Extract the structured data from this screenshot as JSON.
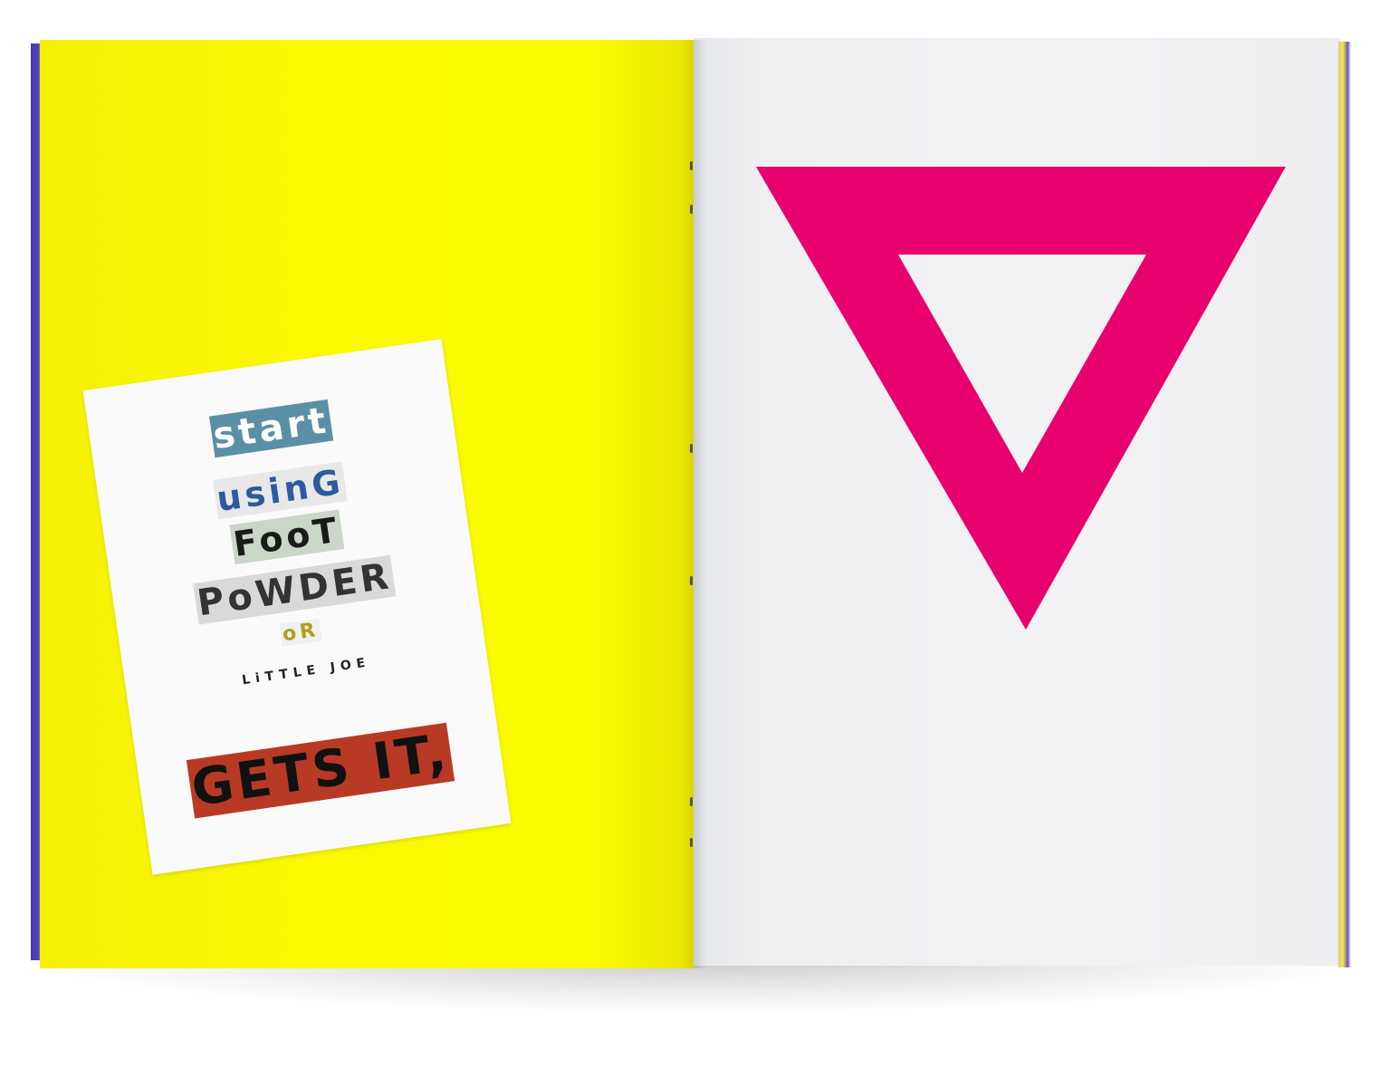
{
  "colors": {
    "left_page": "#fbf800",
    "right_page": "#f1f1f4",
    "triangle": "#e8006e",
    "card": "#fafafa",
    "edge_purple": "#5a44b5"
  },
  "card": {
    "line1": "start",
    "line2": "usinG",
    "line3": "FooT",
    "line4": "PoWDER",
    "line5": "oR",
    "line6": "LiTTLE  JOE",
    "line7": "GETS IT,"
  }
}
